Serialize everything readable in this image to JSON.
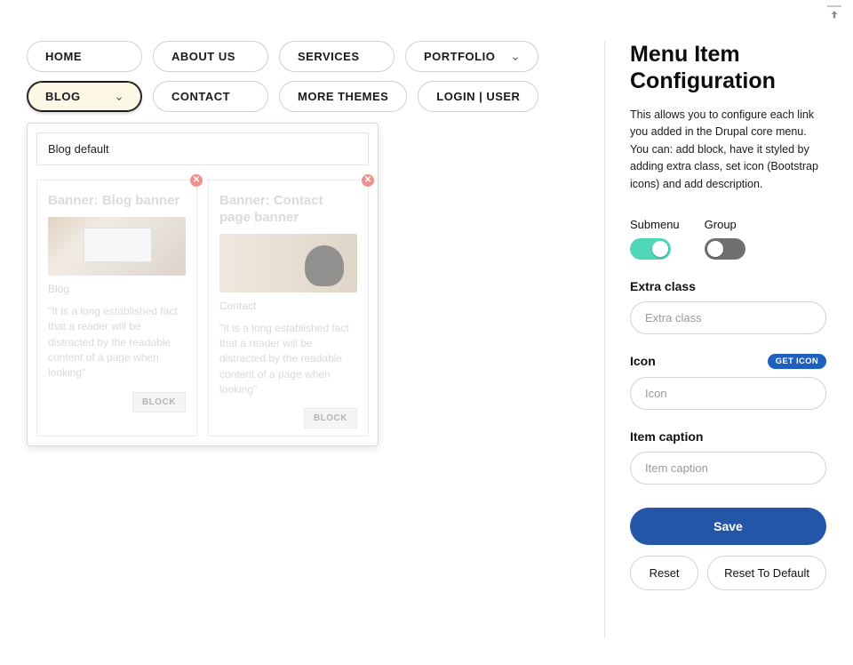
{
  "nav": {
    "items": [
      {
        "label": "HOME",
        "hasChevron": false
      },
      {
        "label": "ABOUT US",
        "hasChevron": false
      },
      {
        "label": "SERVICES",
        "hasChevron": false
      },
      {
        "label": "PORTFOLIO",
        "hasChevron": true
      },
      {
        "label": "BLOG",
        "hasChevron": true,
        "active": true
      },
      {
        "label": "CONTACT",
        "hasChevron": false
      },
      {
        "label": "MORE THEMES",
        "hasChevron": false
      },
      {
        "label": "LOGIN | USER",
        "hasChevron": false
      }
    ]
  },
  "dropdown": {
    "value": "Blog default",
    "cards": [
      {
        "title": "Banner: Blog banner",
        "subtitle": "Blog",
        "desc": "\"It is a long established fact that a reader will be distracted by the readable content of a page when looking\"",
        "block_label": "BLOCK"
      },
      {
        "title": "Banner: Contact page banner",
        "subtitle": "Contact",
        "desc": "\"It is a long established fact that a reader will be distracted by the readable content of a page when looking\"",
        "block_label": "BLOCK"
      }
    ]
  },
  "panel": {
    "title": "Menu Item Configuration",
    "desc": "This allows you to configure each link you added in the Drupal core menu. You can: add block, have it styled by adding extra class, set icon (Bootstrap icons) and add description.",
    "toggles": {
      "submenu_label": "Submenu",
      "group_label": "Group"
    },
    "extra_class": {
      "label": "Extra class",
      "placeholder": "Extra class"
    },
    "icon": {
      "label": "Icon",
      "placeholder": "Icon",
      "badge": "GET ICON"
    },
    "caption": {
      "label": "Item caption",
      "placeholder": "Item caption"
    },
    "buttons": {
      "save": "Save",
      "reset": "Reset",
      "reset_default": "Reset To Default"
    }
  }
}
